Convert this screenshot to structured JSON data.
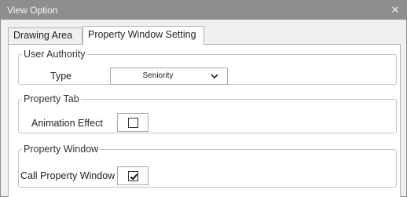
{
  "window": {
    "title": "View Option",
    "close_glyph": "✕"
  },
  "tabs": [
    {
      "label": "Drawing Area",
      "active": false
    },
    {
      "label": "Property Window Setting",
      "active": true
    }
  ],
  "user_authority": {
    "legend": "User Authority",
    "type_label": "Type",
    "type_value": "Seniority"
  },
  "property_tab": {
    "legend": "Property Tab",
    "animation_label": "Animation Effect",
    "animation_checked": false
  },
  "property_window": {
    "legend": "Property Window",
    "call_label": "Call Property Window",
    "call_checked": true
  },
  "icons": {
    "close": "close-icon",
    "dropdown": "chevron-down-icon",
    "check": "check-icon"
  },
  "colors": {
    "titlebar_bg": "#8e8e8e",
    "window_bg": "#f0f0f0",
    "panel_bg": "#ffffff"
  }
}
